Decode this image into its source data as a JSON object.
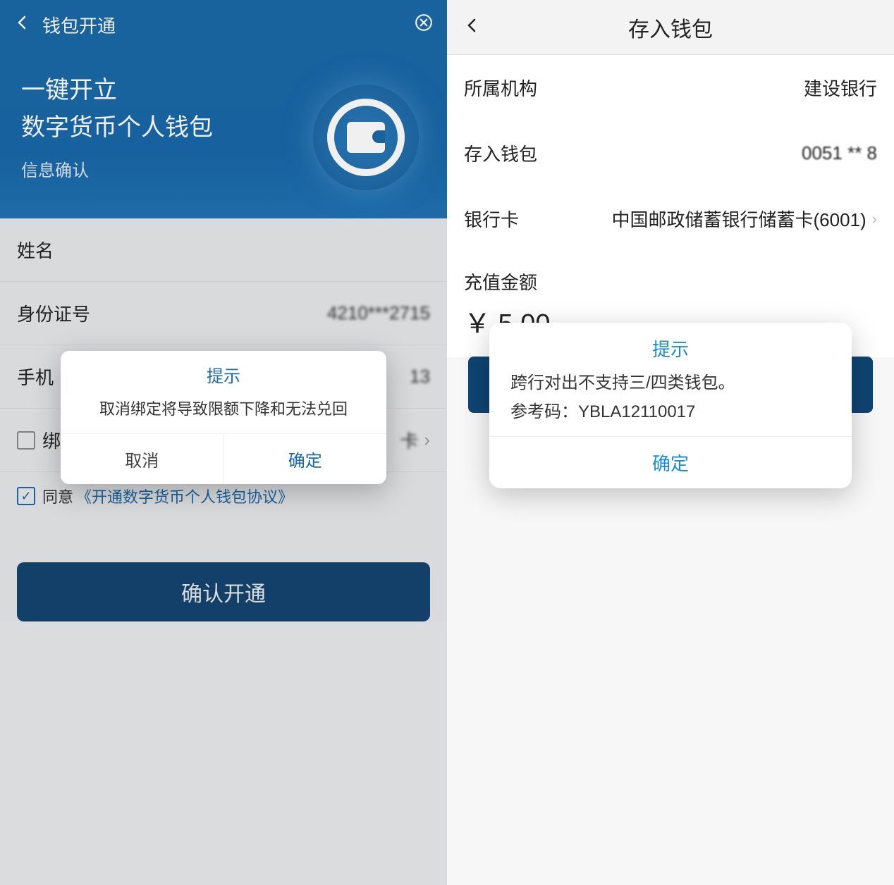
{
  "left": {
    "topbar": {
      "title": "钱包开通"
    },
    "hero": {
      "line1": "一键开立",
      "line2": "数字货币个人钱包",
      "sub": "信息确认"
    },
    "fields": {
      "name_label": "姓名",
      "id_label": "身份证号",
      "id_value": "4210***2715",
      "phone_label": "手机",
      "phone_value_tail": "13",
      "bind_label": "绑",
      "bind_value_tail": "卡"
    },
    "agree": {
      "prefix": "同意",
      "link": "《开通数字货币个人钱包协议》"
    },
    "confirm_label": "确认开通",
    "dialog": {
      "title": "提示",
      "message": "取消绑定将导致限额下降和无法兑回",
      "cancel": "取消",
      "ok": "确定"
    }
  },
  "right": {
    "topbar": {
      "title": "存入钱包"
    },
    "rows": {
      "org_label": "所属机构",
      "org_value": "建设银行",
      "wallet_label": "存入钱包",
      "wallet_value": "0051 ** 8",
      "bank_label": "银行卡",
      "bank_value": "中国邮政储蓄银行储蓄卡(6001)"
    },
    "amount": {
      "label": "充值金额",
      "value": "￥ 5.00"
    },
    "dialog": {
      "title": "提示",
      "message": "跨行对出不支持三/四类钱包。",
      "code_label": "参考码：",
      "code_value": "YBLA12110017",
      "ok": "确定"
    }
  }
}
